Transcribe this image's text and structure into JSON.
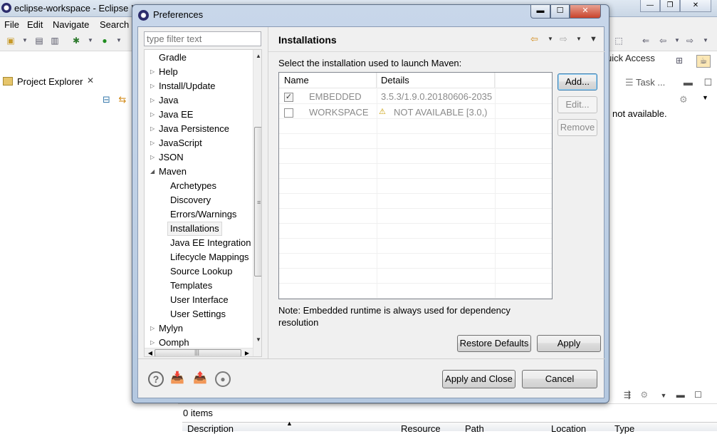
{
  "eclipse": {
    "window_title": "eclipse-workspace - Eclipse I",
    "menu": [
      "File",
      "Edit",
      "Navigate",
      "Search"
    ],
    "quick_access": "uick Access",
    "project_explorer_tab": "Project Explorer",
    "task_tab": "Task ...",
    "not_available_text": "not available.",
    "items_count": "0 items",
    "bottom_columns": [
      "Description",
      "Resource",
      "Path",
      "Location",
      "Type"
    ]
  },
  "dialog": {
    "title": "Preferences",
    "filter_placeholder": "type filter text",
    "tree": [
      {
        "label": "Gradle",
        "level": 0,
        "arrow": ""
      },
      {
        "label": "Help",
        "level": 0,
        "arrow": "collapsed"
      },
      {
        "label": "Install/Update",
        "level": 0,
        "arrow": "collapsed"
      },
      {
        "label": "Java",
        "level": 0,
        "arrow": "collapsed"
      },
      {
        "label": "Java EE",
        "level": 0,
        "arrow": "collapsed"
      },
      {
        "label": "Java Persistence",
        "level": 0,
        "arrow": "collapsed"
      },
      {
        "label": "JavaScript",
        "level": 0,
        "arrow": "collapsed"
      },
      {
        "label": "JSON",
        "level": 0,
        "arrow": "collapsed"
      },
      {
        "label": "Maven",
        "level": 0,
        "arrow": "expanded"
      },
      {
        "label": "Archetypes",
        "level": 1,
        "arrow": ""
      },
      {
        "label": "Discovery",
        "level": 1,
        "arrow": ""
      },
      {
        "label": "Errors/Warnings",
        "level": 1,
        "arrow": ""
      },
      {
        "label": "Installations",
        "level": 1,
        "arrow": "",
        "selected": true
      },
      {
        "label": "Java EE Integration",
        "level": 1,
        "arrow": ""
      },
      {
        "label": "Lifecycle Mappings",
        "level": 1,
        "arrow": ""
      },
      {
        "label": "Source Lookup",
        "level": 1,
        "arrow": ""
      },
      {
        "label": "Templates",
        "level": 1,
        "arrow": ""
      },
      {
        "label": "User Interface",
        "level": 1,
        "arrow": ""
      },
      {
        "label": "User Settings",
        "level": 1,
        "arrow": ""
      },
      {
        "label": "Mylyn",
        "level": 0,
        "arrow": "collapsed"
      },
      {
        "label": "Oomph",
        "level": 0,
        "arrow": "collapsed"
      }
    ],
    "page_title": "Installations",
    "select_label": "Select the installation used to launch Maven:",
    "table": {
      "columns": [
        "Name",
        "Details"
      ],
      "rows": [
        {
          "checked": true,
          "name": "EMBEDDED",
          "details": "3.5.3/1.9.0.20180606-2035",
          "warning": false
        },
        {
          "checked": false,
          "name": "WORKSPACE",
          "details": "NOT AVAILABLE [3.0,)",
          "warning": true
        }
      ]
    },
    "buttons": {
      "add": "Add...",
      "edit": "Edit...",
      "remove": "Remove",
      "restore_defaults": "Restore Defaults",
      "apply": "Apply",
      "apply_and_close": "Apply and Close",
      "cancel": "Cancel"
    },
    "note": "Note: Embedded runtime is always used for dependency resolution"
  }
}
